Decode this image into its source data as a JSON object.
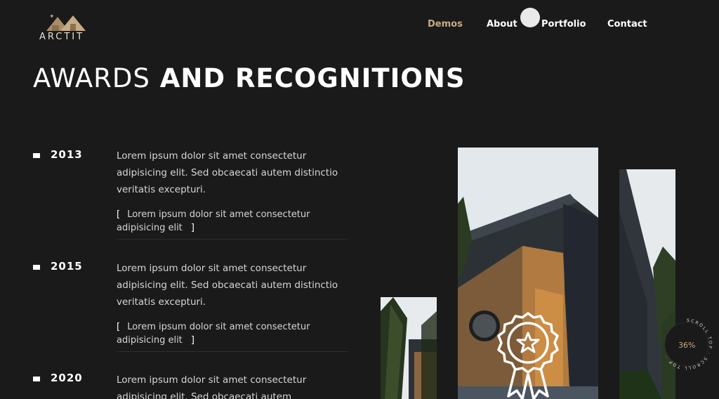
{
  "brand": {
    "name": "ARCTIT"
  },
  "nav": {
    "items": [
      {
        "label": "Demos"
      },
      {
        "label": "About"
      },
      {
        "label": "Portfolio"
      },
      {
        "label": "Contact"
      }
    ]
  },
  "section": {
    "title_light": "AWARDS",
    "title_bold": "AND RECOGNITIONS"
  },
  "awards": [
    {
      "year": "2013",
      "description": "Lorem ipsum dolor sit amet consectetur adipisicing elit. Sed obcaecati autem distinctio veritatis excepturi.",
      "quote": "Lorem ipsum dolor sit amet consectetur adipisicing elit"
    },
    {
      "year": "2015",
      "description": "Lorem ipsum dolor sit amet consectetur adipisicing elit. Sed obcaecati autem distinctio veritatis excepturi.",
      "quote": "Lorem ipsum dolor sit amet consectetur adipisicing elit"
    },
    {
      "year": "2020",
      "description": "Lorem ipsum dolor sit amet consectetur adipisicing elit. Sed obcaecati autem",
      "quote": ""
    }
  ],
  "quote_brackets": {
    "open": "[",
    "close": "]"
  },
  "scroll_top": {
    "label": "SCROLL TOP · SCROLL TOP · ",
    "progress": "36%"
  },
  "colors": {
    "accent": "#c6ab84",
    "background": "#1a1a1a"
  },
  "icons": {
    "award": "award-ribbon-icon",
    "logo": "house-roof-icon"
  }
}
